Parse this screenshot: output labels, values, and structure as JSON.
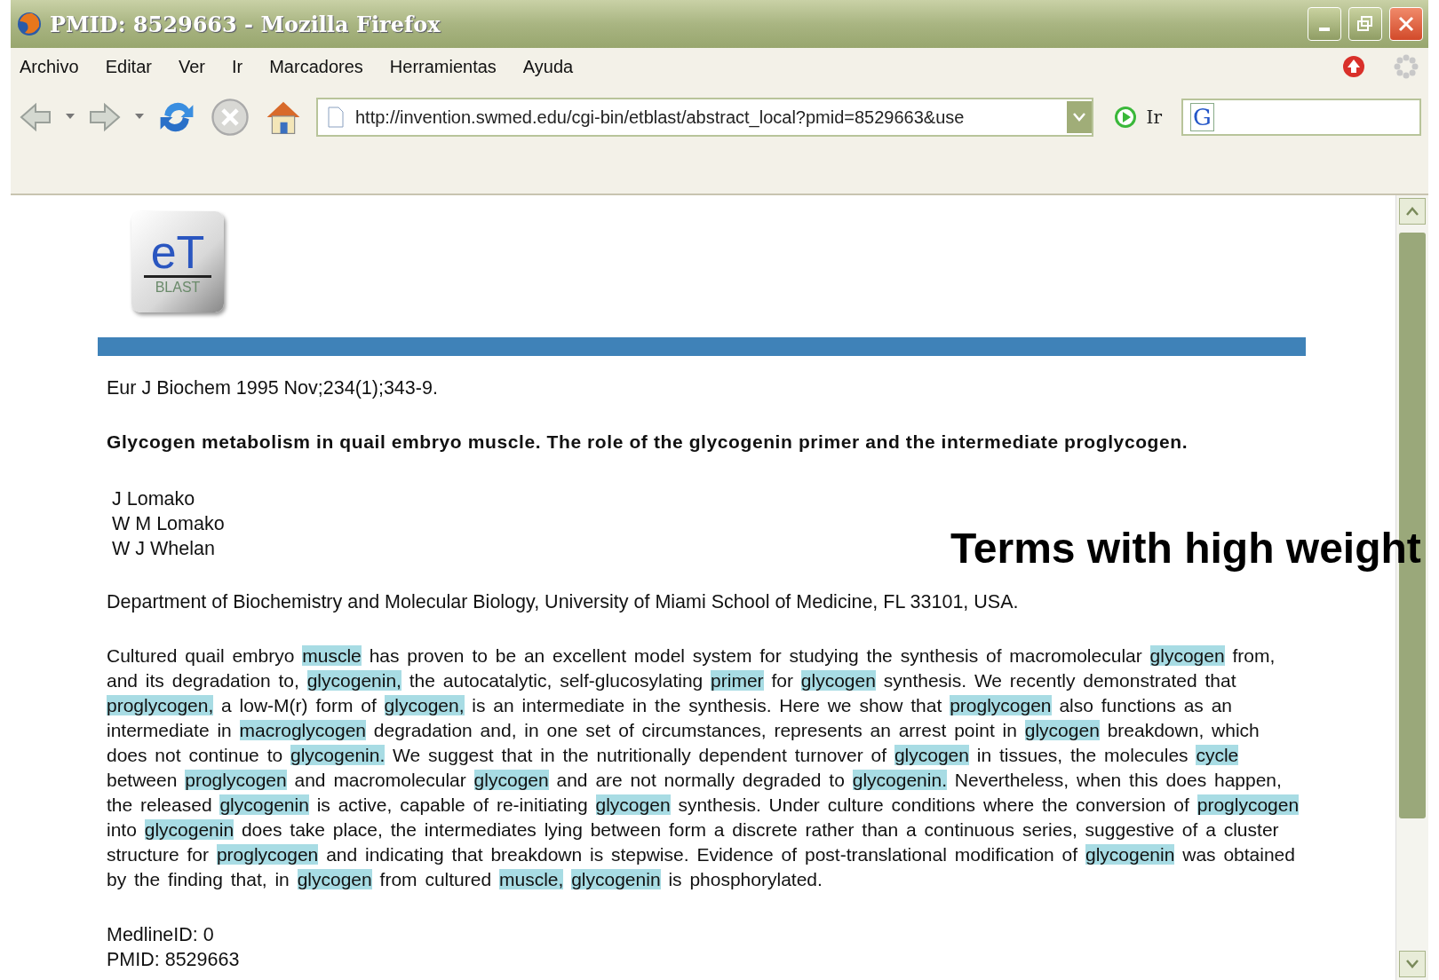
{
  "window": {
    "title": "PMID: 8529663 - Mozilla Firefox"
  },
  "menu": [
    "Archivo",
    "Editar",
    "Ver",
    "Ir",
    "Marcadores",
    "Herramientas",
    "Ayuda"
  ],
  "address_bar": {
    "value": "http://invention.swmed.edu/cgi-bin/etblast/abstract_local?pmid=8529663&use",
    "go_label": "Ir"
  },
  "search_field": {
    "engine_letter": "G"
  },
  "logo": {
    "main": "eT",
    "sub": "BLAST"
  },
  "article": {
    "citation": "Eur J Biochem 1995 Nov;234(1);343-9.",
    "title": "Glycogen metabolism in quail embryo muscle. The role of the glycogenin primer and the intermediate proglycogen.",
    "authors": [
      "J Lomako",
      "W M Lomako",
      "W J Whelan"
    ],
    "affiliation": "Department of Biochemistry and Molecular Biology, University of Miami School of Medicine, FL 33101, USA.",
    "abstract": [
      {
        "text": "Cultured quail embryo ",
        "highlighted": false
      },
      {
        "text": "muscle",
        "highlighted": true
      },
      {
        "text": " has proven to be an excellent model system for studying the synthesis of macromolecular ",
        "highlighted": false
      },
      {
        "text": "glycogen",
        "highlighted": true
      },
      {
        "text": " from, and its degradation to, ",
        "highlighted": false
      },
      {
        "text": "glycogenin,",
        "highlighted": true
      },
      {
        "text": " the autocatalytic, self-glucosylating ",
        "highlighted": false
      },
      {
        "text": "primer",
        "highlighted": true
      },
      {
        "text": " for ",
        "highlighted": false
      },
      {
        "text": "glycogen",
        "highlighted": true
      },
      {
        "text": " synthesis. We recently demonstrated that ",
        "highlighted": false
      },
      {
        "text": "proglycogen,",
        "highlighted": true
      },
      {
        "text": " a low-M(r) form of ",
        "highlighted": false
      },
      {
        "text": "glycogen,",
        "highlighted": true
      },
      {
        "text": " is an intermediate in the synthesis. Here we show that ",
        "highlighted": false
      },
      {
        "text": "proglycogen",
        "highlighted": true
      },
      {
        "text": " also functions as an intermediate in ",
        "highlighted": false
      },
      {
        "text": "macroglycogen",
        "highlighted": true
      },
      {
        "text": " degradation and, in one set of circumstances, represents an arrest point in ",
        "highlighted": false
      },
      {
        "text": "glycogen",
        "highlighted": true
      },
      {
        "text": " breakdown, which does not continue to ",
        "highlighted": false
      },
      {
        "text": "glycogenin.",
        "highlighted": true
      },
      {
        "text": " We suggest that in the nutritionally dependent turnover of ",
        "highlighted": false
      },
      {
        "text": "glycogen",
        "highlighted": true
      },
      {
        "text": " in tissues, the molecules ",
        "highlighted": false
      },
      {
        "text": "cycle",
        "highlighted": true
      },
      {
        "text": " between ",
        "highlighted": false
      },
      {
        "text": "proglycogen",
        "highlighted": true
      },
      {
        "text": " and macromolecular ",
        "highlighted": false
      },
      {
        "text": "glycogen",
        "highlighted": true
      },
      {
        "text": " and are not normally degraded to ",
        "highlighted": false
      },
      {
        "text": "glycogenin.",
        "highlighted": true
      },
      {
        "text": " Nevertheless, when this does happen, the released ",
        "highlighted": false
      },
      {
        "text": "glycogenin",
        "highlighted": true
      },
      {
        "text": " is active, capable of re-initiating ",
        "highlighted": false
      },
      {
        "text": "glycogen",
        "highlighted": true
      },
      {
        "text": " synthesis. Under culture conditions where the conversion of ",
        "highlighted": false
      },
      {
        "text": "proglycogen",
        "highlighted": true
      },
      {
        "text": " into ",
        "highlighted": false
      },
      {
        "text": "glycogenin",
        "highlighted": true
      },
      {
        "text": " does take place, the intermediates lying between form a discrete rather than a continuous series, suggestive of a cluster structure for ",
        "highlighted": false
      },
      {
        "text": "proglycogen",
        "highlighted": true
      },
      {
        "text": " and indicating that breakdown is stepwise. Evidence of post-translational modification of ",
        "highlighted": false
      },
      {
        "text": "glycogenin",
        "highlighted": true
      },
      {
        "text": " was obtained by the finding that, in ",
        "highlighted": false
      },
      {
        "text": "glycogen",
        "highlighted": true
      },
      {
        "text": " from cultured ",
        "highlighted": false
      },
      {
        "text": "muscle, ",
        "highlighted": true
      },
      {
        "text": "glycogenin",
        "highlighted": true
      },
      {
        "text": " is phosphorylated.",
        "highlighted": false
      }
    ],
    "ids": [
      "MedlineID: 0",
      "PMID: 8529663"
    ]
  },
  "annotation": "Terms with high weight"
}
